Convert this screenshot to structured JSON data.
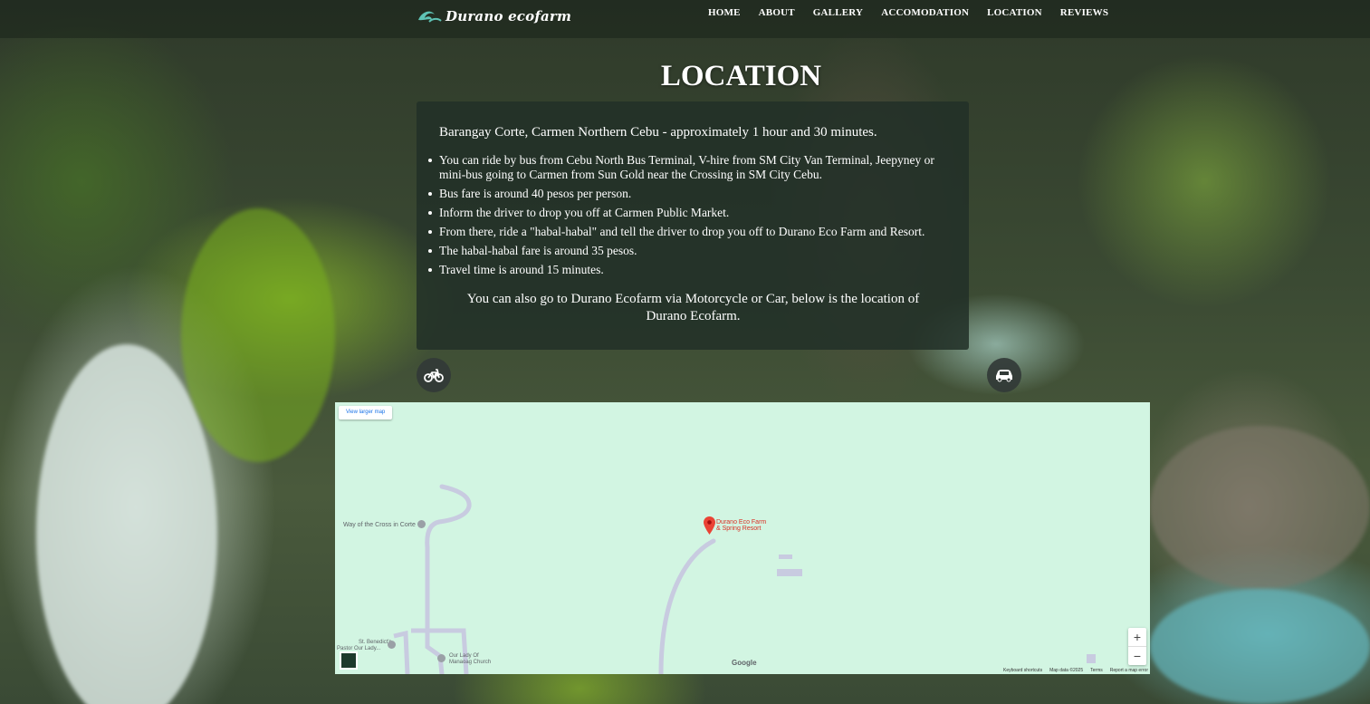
{
  "brand": {
    "name": "Durano ecofarm"
  },
  "nav": {
    "items": [
      "HOME",
      "ABOUT",
      "GALLERY",
      "ACCOMODATION",
      "LOCATION",
      "REVIEWS"
    ]
  },
  "page": {
    "title": "LOCATION"
  },
  "card": {
    "intro": "Barangay Corte, Carmen Northern Cebu - approximately 1 hour and 30 minutes.",
    "bullets": [
      "You can ride by bus from Cebu North Bus Terminal, V-hire from SM City Van Terminal, Jeepyney or mini-bus going to Carmen from Sun Gold near the Crossing in SM City Cebu.",
      "Bus fare is around 40 pesos per person.",
      "Inform the driver to drop you off at Carmen Public Market.",
      "From there, ride a \"habal-habal\" and tell the driver to drop you off to Durano Eco Farm and Resort.",
      "The habal-habal fare is around 35 pesos.",
      "Travel time is around 15 minutes."
    ],
    "outro": "You can also go to Durano Ecofarm via Motorcycle or Car, below is the location of Durano Ecofarm."
  },
  "icons": {
    "left": "motorcycle-icon",
    "right": "car-icon"
  },
  "map": {
    "view_larger": "View larger map",
    "labels": {
      "way_of_cross": "Way of the Cross in Corte",
      "st_benedict": "St. Benedict's",
      "st_benedict_2": "Pastor Our Lady...",
      "our_lady": "Our Lady Of",
      "our_lady_2": "Manaoag Church",
      "poi_1": "Durano Eco Farm",
      "poi_2": "& Spring Resort"
    },
    "zoom_in": "+",
    "zoom_out": "−",
    "google": "Google",
    "attribution": [
      "Keyboard shortcuts",
      "Map data ©2025",
      "Terms",
      "Report a map error"
    ],
    "background_color": "#d2f5e2",
    "road_color": "#c8cbe0",
    "pin_color": "#ea4335"
  }
}
